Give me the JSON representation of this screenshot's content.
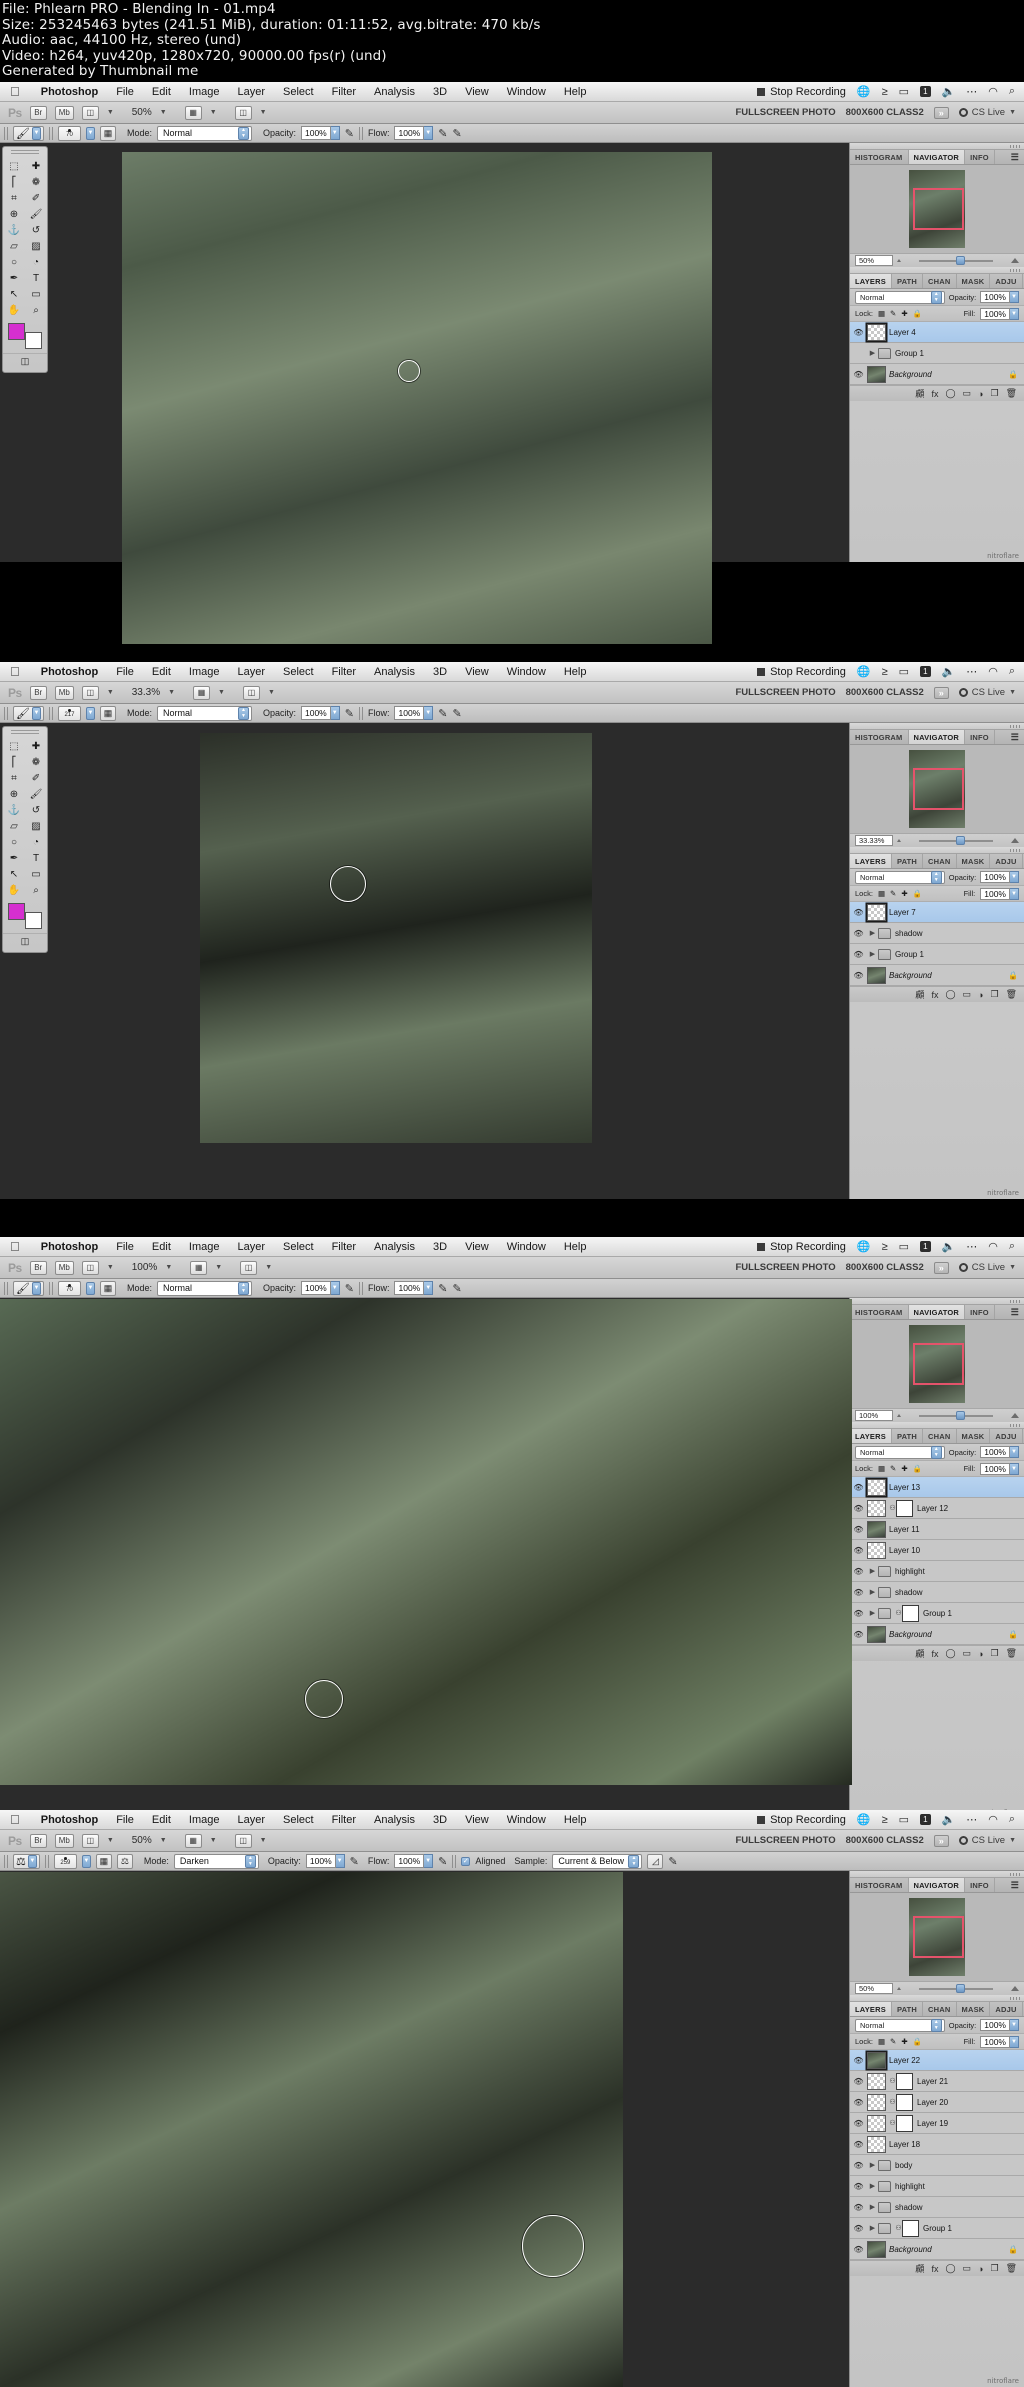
{
  "video_info": {
    "lines": [
      "File: Phlearn PRO - Blending In - 01.mp4",
      "Size: 253245463 bytes (241.51 MiB), duration: 01:11:52, avg.bitrate: 470 kb/s",
      "Audio: aac, 44100 Hz, stereo (und)",
      "Video: h264, yuv420p, 1280x720, 90000.00 fps(r) (und)",
      "Generated by Thumbnail me"
    ]
  },
  "menubar": {
    "apple_icon": "apple-icon",
    "items": [
      "Photoshop",
      "File",
      "Edit",
      "Image",
      "Layer",
      "Select",
      "Filter",
      "Analysis",
      "3D",
      "View",
      "Window",
      "Help"
    ],
    "stop_recording": "Stop Recording",
    "status_icons": [
      "globe-icon",
      "airplay-icon",
      "display-icon",
      "spaces-icon",
      "volume-icon",
      "ellipsis-icon",
      "wifi-icon",
      "search-icon"
    ],
    "badge": "1"
  },
  "appbar": {
    "logo": "Ps",
    "bridge": "Br",
    "minibridge": "Mb",
    "view_extras_icon": "view-extras-icon",
    "arrange_icon": "arrange-documents-icon",
    "screenmode_icon": "screen-mode-icon",
    "workspace_1": "FULLSCREEN PHOTO",
    "workspace_2": "800X600 CLASS2",
    "more_chevron": "»",
    "cslive": "CS Live"
  },
  "options_brush": {
    "tool_icon": "brush-tool-icon",
    "mode_label": "Mode:",
    "mode_value": "Normal",
    "opacity_label": "Opacity:",
    "opacity_value": "100%",
    "flow_label": "Flow:",
    "flow_value": "100%",
    "airbrush_icon": "airbrush-icon",
    "tablet_icon": "tablet-pressure-icon"
  },
  "options_clone": {
    "tool_icon": "clone-stamp-tool-icon",
    "brush_size": "259",
    "mode_label": "Mode:",
    "mode_value": "Darken",
    "opacity_label": "Opacity:",
    "opacity_value": "100%",
    "flow_label": "Flow:",
    "flow_value": "100%",
    "aligned_label": "Aligned",
    "sample_label": "Sample:",
    "sample_value": "Current & Below",
    "ignore_adj_icon": "ignore-adjustment-layers-icon",
    "airbrush_icon": "airbrush-icon"
  },
  "tools_palette": {
    "items": [
      "marquee-tool",
      "move-tool",
      "lasso-tool",
      "quick-select-tool",
      "crop-tool",
      "eyedropper-tool",
      "spot-heal-tool",
      "brush-tool",
      "clone-stamp-tool",
      "history-brush-tool",
      "eraser-tool",
      "gradient-tool",
      "blur-tool",
      "dodge-tool",
      "pen-tool",
      "type-tool",
      "path-select-tool",
      "shape-tool",
      "hand-tool",
      "zoom-tool"
    ],
    "quickmask_icon": "quick-mask-icon"
  },
  "panel_tabs": {
    "top": [
      "HISTOGRAM",
      "NAVIGATOR",
      "INFO"
    ],
    "top_active": "NAVIGATOR",
    "layers": [
      "LAYERS",
      "PATH",
      "CHAN",
      "MASK",
      "ADJU"
    ],
    "layers_active": "LAYERS",
    "menu_icon": "panel-menu-icon"
  },
  "layers_panel_labels": {
    "blend_mode": "Normal",
    "opacity_label": "Opacity:",
    "opacity_value": "100%",
    "lock_label": "Lock:",
    "fill_label": "Fill:",
    "fill_value": "100%",
    "lock_icons": [
      "lock-transparency-icon",
      "lock-image-icon",
      "lock-position-icon",
      "lock-all-icon"
    ],
    "footer_icons": [
      "link-layers-icon",
      "layer-style-icon",
      "layer-mask-icon",
      "new-group-icon",
      "new-adjustment-icon",
      "new-layer-icon",
      "delete-layer-icon"
    ]
  },
  "dock_icons": [
    "history-panel-icon",
    "actions-panel-icon",
    "color-panel-icon",
    "swatches-panel-icon"
  ],
  "watermark": "nitroflare",
  "shots": [
    {
      "id": "shot-1",
      "zoom_appbar": "50%",
      "zoom_navigator": "50%",
      "brush_size": "70",
      "options_type": "brush",
      "layers": [
        {
          "name": "Layer 4",
          "type": "pixel",
          "selected": true,
          "visible": true,
          "thumb": "transparent"
        },
        {
          "name": "Group 1",
          "type": "group",
          "selected": false,
          "visible": false,
          "thumb": "folder"
        },
        {
          "name": "Background",
          "type": "background",
          "selected": false,
          "visible": true,
          "thumb": "photo",
          "locked": true
        }
      ]
    },
    {
      "id": "shot-2",
      "zoom_appbar": "33.3%",
      "zoom_navigator": "33.33%",
      "brush_size": "217",
      "options_type": "brush",
      "layers": [
        {
          "name": "Layer 7",
          "type": "pixel",
          "selected": true,
          "visible": true,
          "thumb": "transparent"
        },
        {
          "name": "shadow",
          "type": "group",
          "selected": false,
          "visible": true,
          "thumb": "folder"
        },
        {
          "name": "Group 1",
          "type": "group",
          "selected": false,
          "visible": true,
          "thumb": "folder"
        },
        {
          "name": "Background",
          "type": "background",
          "selected": false,
          "visible": true,
          "thumb": "photo",
          "locked": true
        }
      ]
    },
    {
      "id": "shot-3",
      "zoom_appbar": "100%",
      "zoom_navigator": "100%",
      "brush_size": "70",
      "options_type": "brush",
      "layers": [
        {
          "name": "Layer 13",
          "type": "pixel",
          "selected": true,
          "visible": true,
          "thumb": "transparent"
        },
        {
          "name": "Layer 12",
          "type": "masked",
          "selected": false,
          "visible": true,
          "thumb": "transparent"
        },
        {
          "name": "Layer 11",
          "type": "pixel",
          "selected": false,
          "visible": true,
          "thumb": "photo"
        },
        {
          "name": "Layer 10",
          "type": "pixel",
          "selected": false,
          "visible": true,
          "thumb": "transparent"
        },
        {
          "name": "highlight",
          "type": "group",
          "selected": false,
          "visible": true,
          "thumb": "folder"
        },
        {
          "name": "shadow",
          "type": "group",
          "selected": false,
          "visible": true,
          "thumb": "folder"
        },
        {
          "name": "Group 1",
          "type": "group-masked",
          "selected": false,
          "visible": true,
          "thumb": "folder"
        },
        {
          "name": "Background",
          "type": "background",
          "selected": false,
          "visible": true,
          "thumb": "photo",
          "locked": true
        }
      ]
    },
    {
      "id": "shot-4",
      "zoom_appbar": "50%",
      "zoom_navigator": "50%",
      "brush_size": "259",
      "options_type": "clone",
      "layers": [
        {
          "name": "Layer 22",
          "type": "pixel",
          "selected": true,
          "visible": true,
          "thumb": "photo"
        },
        {
          "name": "Layer 21",
          "type": "masked",
          "selected": false,
          "visible": true,
          "thumb": "transparent"
        },
        {
          "name": "Layer 20",
          "type": "masked",
          "selected": false,
          "visible": true,
          "thumb": "transparent"
        },
        {
          "name": "Layer 19",
          "type": "masked",
          "selected": false,
          "visible": true,
          "thumb": "transparent"
        },
        {
          "name": "Layer 18",
          "type": "pixel",
          "selected": false,
          "visible": true,
          "thumb": "transparent"
        },
        {
          "name": "body",
          "type": "group",
          "selected": false,
          "visible": true,
          "thumb": "folder"
        },
        {
          "name": "highlight",
          "type": "group",
          "selected": false,
          "visible": true,
          "thumb": "folder"
        },
        {
          "name": "shadow",
          "type": "group",
          "selected": false,
          "visible": true,
          "thumb": "folder"
        },
        {
          "name": "Group 1",
          "type": "group-masked",
          "selected": false,
          "visible": true,
          "thumb": "folder"
        },
        {
          "name": "Background",
          "type": "background",
          "selected": false,
          "visible": true,
          "thumb": "photo",
          "locked": true
        }
      ]
    }
  ],
  "colors": {
    "nav_rect": "#e4536b",
    "selection_blue": "#a8c8ea",
    "foreground_swatch": "#d52fcf",
    "wall_green": "#5c6f60"
  }
}
